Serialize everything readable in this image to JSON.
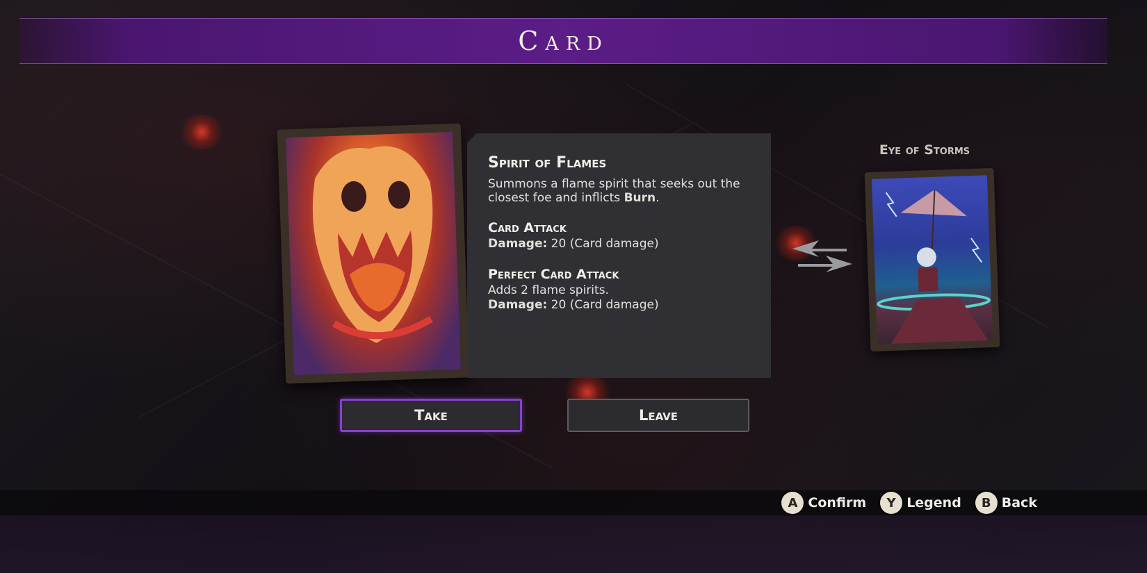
{
  "header": {
    "title": "Card"
  },
  "offered_card": {
    "name": "Spirit of Flames",
    "description_prefix": "Summons a flame spirit that seeks out the closest foe and inflicts ",
    "description_keyword": "Burn",
    "description_suffix": ".",
    "card_attack": {
      "title": "Card Attack",
      "damage_label": "Damage:",
      "damage_value": "20 (Card damage)"
    },
    "perfect_attack": {
      "title": "Perfect Card Attack",
      "effect": "Adds 2 flame spirits.",
      "damage_label": "Damage:",
      "damage_value": "20 (Card damage)"
    }
  },
  "current_card": {
    "name": "Eye of Storms"
  },
  "actions": {
    "take_label": "Take",
    "leave_label": "Leave"
  },
  "controller_hints": [
    {
      "button": "A",
      "label": "Confirm"
    },
    {
      "button": "Y",
      "label": "Legend"
    },
    {
      "button": "B",
      "label": "Back"
    }
  ],
  "colors": {
    "accent_purple": "#8a3fd1",
    "title_bar": "#5b1d86"
  }
}
